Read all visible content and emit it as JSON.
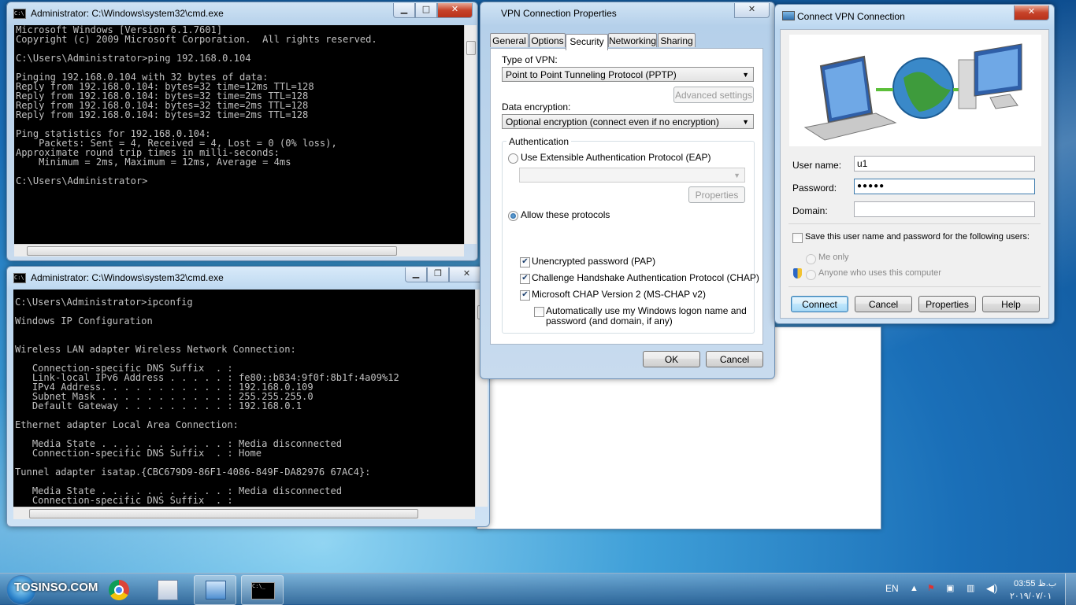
{
  "cmd1": {
    "title": "Administrator: C:\\Windows\\system32\\cmd.exe",
    "output": "Microsoft Windows [Version 6.1.7601]\nCopyright (c) 2009 Microsoft Corporation.  All rights reserved.\n\nC:\\Users\\Administrator>ping 192.168.0.104\n\nPinging 192.168.0.104 with 32 bytes of data:\nReply from 192.168.0.104: bytes=32 time=12ms TTL=128\nReply from 192.168.0.104: bytes=32 time=2ms TTL=128\nReply from 192.168.0.104: bytes=32 time=2ms TTL=128\nReply from 192.168.0.104: bytes=32 time=2ms TTL=128\n\nPing statistics for 192.168.0.104:\n    Packets: Sent = 4, Received = 4, Lost = 0 (0% loss),\nApproximate round trip times in milli-seconds:\n    Minimum = 2ms, Maximum = 12ms, Average = 4ms\n\nC:\\Users\\Administrator>"
  },
  "cmd2": {
    "title": "Administrator: C:\\Windows\\system32\\cmd.exe",
    "output": "C:\\Users\\Administrator>ipconfig\n\nWindows IP Configuration\n\n\nWireless LAN adapter Wireless Network Connection:\n\n   Connection-specific DNS Suffix  . :\n   Link-local IPv6 Address . . . . . : fe80::b834:9f0f:8b1f:4a09%12\n   IPv4 Address. . . . . . . . . . . : 192.168.0.109\n   Subnet Mask . . . . . . . . . . . : 255.255.255.0\n   Default Gateway . . . . . . . . . : 192.168.0.1\n\nEthernet adapter Local Area Connection:\n\n   Media State . . . . . . . . . . . : Media disconnected\n   Connection-specific DNS Suffix  . : Home\n\nTunnel adapter isatap.{CBC679D9-86F1-4086-849F-DA82976 67AC4}:\n\n   Media State . . . . . . . . . . . : Media disconnected\n   Connection-specific DNS Suffix  . :"
  },
  "vpnprops": {
    "title": "VPN Connection Properties",
    "tabs": [
      "General",
      "Options",
      "Security",
      "Networking",
      "Sharing"
    ],
    "type_label": "Type of VPN:",
    "type_value": "Point to Point Tunneling Protocol (PPTP)",
    "advanced_label": "Advanced settings",
    "encryption_label": "Data encryption:",
    "encryption_value": "Optional encryption (connect even if no encryption)",
    "auth_label": "Authentication",
    "eap_label": "Use Extensible Authentication Protocol (EAP)",
    "properties_label": "Properties",
    "allow_label": "Allow these protocols",
    "pap_label": "Unencrypted password (PAP)",
    "chap_label": "Challenge Handshake Authentication Protocol (CHAP)",
    "mschap_label": "Microsoft CHAP Version 2 (MS-CHAP v2)",
    "autologon_label_1": "Automatically use my Windows logon name and",
    "autologon_label_2": "password (and domain, if any)",
    "ok_label": "OK",
    "cancel_label": "Cancel"
  },
  "connect": {
    "title": "Connect VPN Connection",
    "username_label": "User name:",
    "username_value": "u1",
    "password_label": "Password:",
    "password_value": "●●●●●",
    "domain_label": "Domain:",
    "domain_value": "",
    "save_label": "Save this user name and password for the following users:",
    "me_only_label": "Me only",
    "anyone_label": "Anyone who uses this computer",
    "connect_label": "Connect",
    "cancel_label": "Cancel",
    "properties_label": "Properties",
    "help_label": "Help"
  },
  "taskbar": {
    "watermark": "TOSINSO.COM",
    "language": "EN",
    "time": "03:55 ب.ظ",
    "date": "۲۰۱۹/۰۷/۰۱"
  },
  "colors": {
    "accent": "#3c7fb1",
    "console_bg": "#000000",
    "console_fg": "#c0c0c0"
  }
}
